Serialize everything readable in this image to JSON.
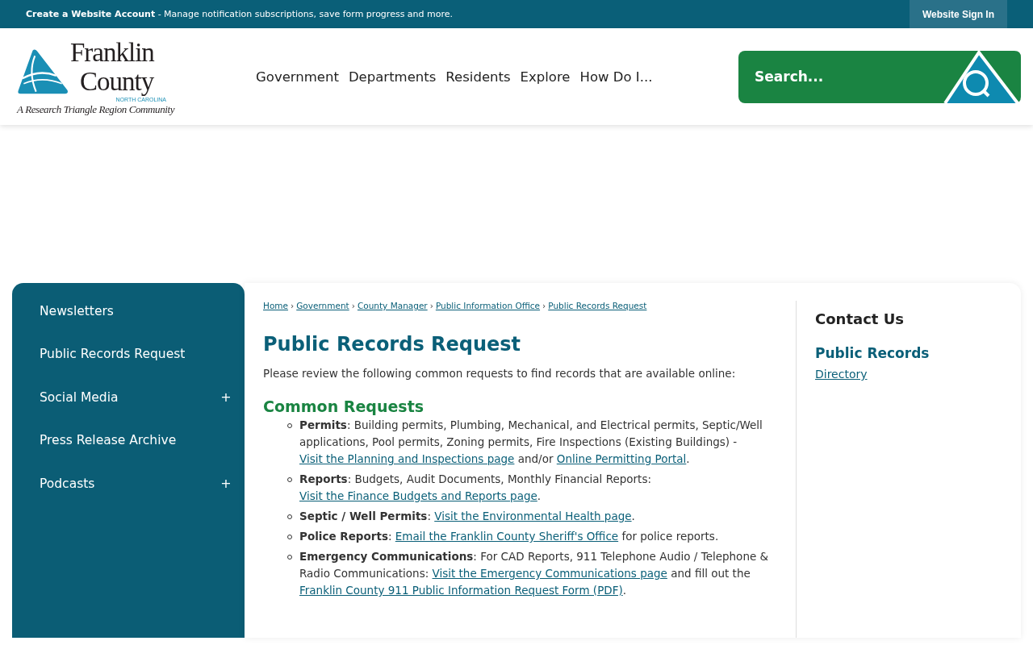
{
  "top_bar": {
    "account_text": "**Create a Website Account** - Manage notification subscriptions, save form progress and more.",
    "sign_in": "Website Sign In"
  },
  "header": {
    "logo": {
      "line_1": "Franklin",
      "line_2": "County",
      "state": "NORTH CAROLINA",
      "tagline": "A Research Triangle Region Community"
    },
    "nav": [
      "Government",
      "Departments",
      "Residents",
      "Explore",
      "How Do I..."
    ],
    "search": {
      "placeholder": "Search..."
    }
  },
  "sidebar": {
    "items": [
      {
        "label": "Newsletters"
      },
      {
        "label": "Public Records Request"
      },
      {
        "label": "Social Media",
        "toggle": "+"
      },
      {
        "label": "Press Release Archive"
      },
      {
        "label": "Podcasts",
        "toggle": "+"
      }
    ]
  },
  "breadcrumbs": [
    "Home",
    "Government",
    "County Manager",
    "Public Information Office",
    "Public Records Request"
  ],
  "breadcrumb_separator": "›",
  "title": "Public Records Request",
  "intro": "Please review the following common requests to find records that are available online:",
  "section_title": "Common Requests",
  "requests": [
    {
      "parts": [
        {
          "kind": "text",
          "text": "**Permits**: Building permits, Plumbing, Mechanical, and Electrical permits, Septic/Well applications, Pool permits, Zoning permits, Fire Inspections (Existing Buildings) - "
        },
        {
          "kind": "link",
          "text": "Visit the Planning and Inspections page"
        },
        {
          "kind": "text",
          "text": " and/or "
        },
        {
          "kind": "link",
          "text": "Online Permitting Portal"
        },
        {
          "kind": "text",
          "text": "."
        }
      ]
    },
    {
      "parts": [
        {
          "kind": "text",
          "text": "**Reports**: Budgets, Audit Documents, Monthly Financial Reports: "
        },
        {
          "kind": "link",
          "text": "Visit the Finance Budgets and Reports page"
        },
        {
          "kind": "text",
          "text": "."
        }
      ]
    },
    {
      "parts": [
        {
          "kind": "text",
          "text": "**Septic / Well Permits**: "
        },
        {
          "kind": "link",
          "text": "Visit the Environmental Health page"
        },
        {
          "kind": "text",
          "text": "."
        }
      ]
    },
    {
      "parts": [
        {
          "kind": "text",
          "text": "**Police Reports**: "
        },
        {
          "kind": "link",
          "text": "Email the Franklin County Sheriff's Office"
        },
        {
          "kind": "text",
          "text": " for police reports."
        }
      ]
    },
    {
      "parts": [
        {
          "kind": "text",
          "text": "**Emergency Communications**: For CAD Reports, 911 Telephone Audio / Telephone & Radio Communications: "
        },
        {
          "kind": "link",
          "text": "Visit the Emergency Communications page"
        },
        {
          "kind": "text",
          "text": " and fill out the "
        },
        {
          "kind": "link",
          "text": "Franklin County 911 Public Information Request Form (PDF)"
        },
        {
          "kind": "text",
          "text": "."
        }
      ]
    }
  ],
  "contact": {
    "heading": "Contact Us",
    "subheading": "Public Records",
    "link": "Directory"
  }
}
